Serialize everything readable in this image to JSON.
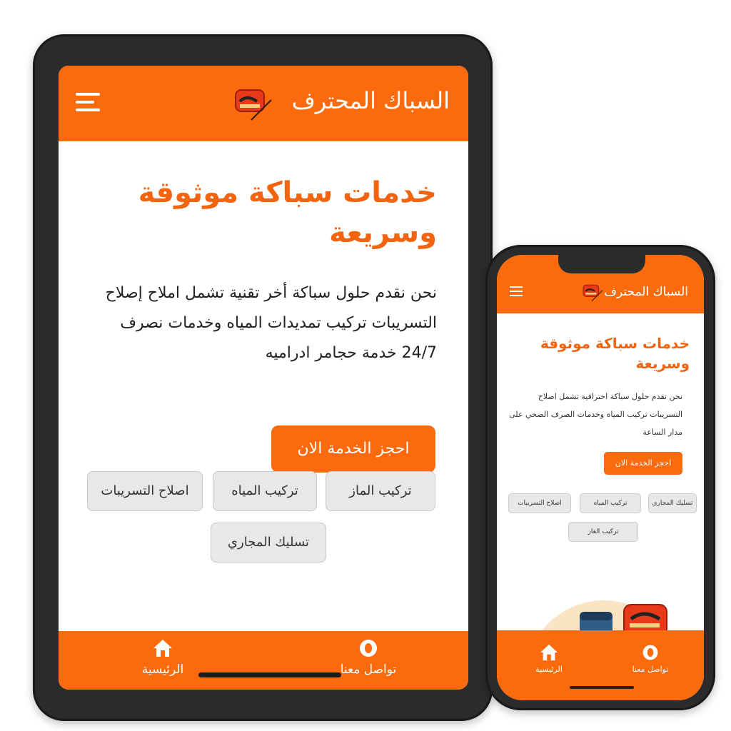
{
  "tablet": {
    "brand": "السباك المحترف",
    "hero_title": "خدمات سباكة موثوقة وسريعة",
    "hero_description": "نحن نقدم حلول سباكة أخر تقنية تشمل املاح إصلاح التسريبات تركيب تمديدات المياه وخدمات نصرف 24/7 خدمة حجامر ادراميه",
    "cta_label": "احجز الخدمة الان",
    "services": [
      "اصلاح التسريبات",
      "تركيب المياه",
      "تركيب الماز",
      "تسليك المجاري"
    ],
    "nav": [
      {
        "label": "الرئيسية",
        "icon": "home-icon"
      },
      {
        "label": "تواصل معنا",
        "icon": "contact-icon"
      }
    ]
  },
  "phone": {
    "brand": "السباك المحترف",
    "hero_title": "خدمات سباكة موثوقة وسريعة",
    "hero_description": "نحن نقدم حلول سباكة احترافية تشمل اصلاح التسريبات تركيب المياه وخدمات الصرف الصحي على مدار الساعة",
    "cta_label": "احجز الخدمة الان",
    "services": [
      "اصلاح التسريبات",
      "تركيب المياه",
      "تسليك المجاري",
      "تركيب الغاز"
    ],
    "nav": [
      {
        "label": "الرئيسية",
        "icon": "home-icon"
      },
      {
        "label": "تواصل معنا",
        "icon": "contact-icon"
      }
    ]
  },
  "colors": {
    "accent": "#fb6a0c",
    "title": "#f26410",
    "chip_bg": "#e7e8ea",
    "frame": "#2b2b2b"
  }
}
